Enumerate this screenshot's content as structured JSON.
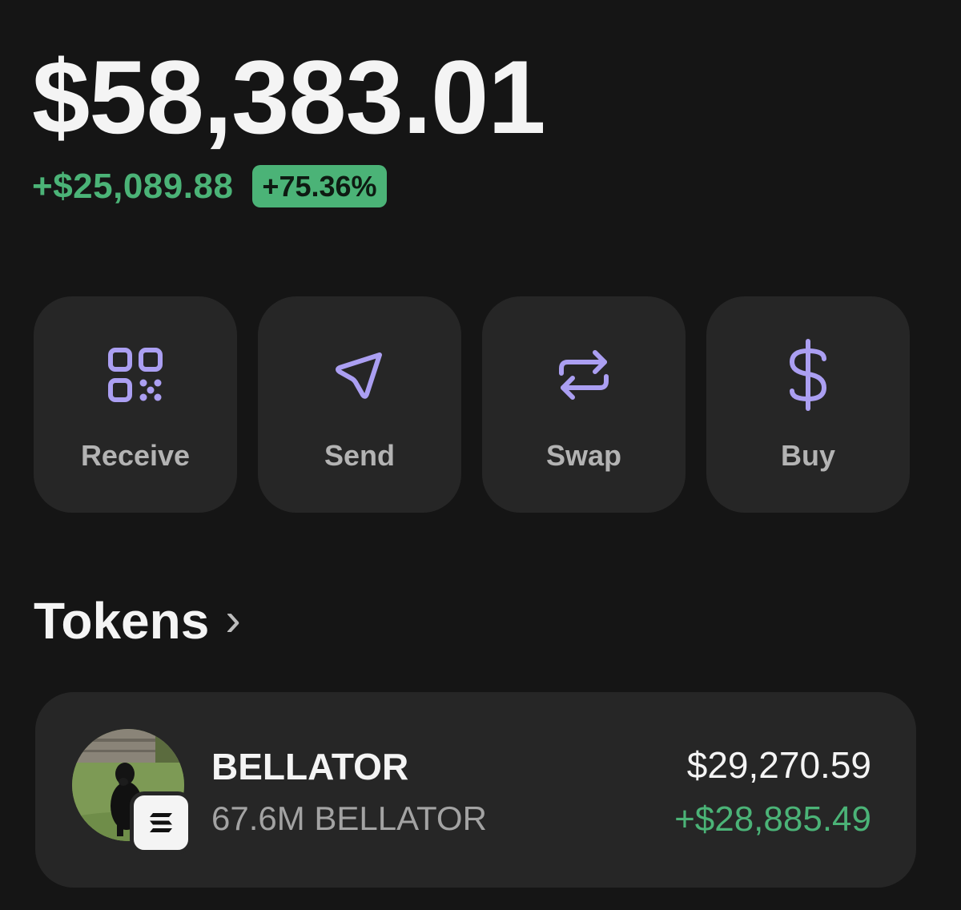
{
  "portfolio": {
    "balance": "$58,383.01",
    "change_amount": "+$25,089.88",
    "change_percent": "+75.36%"
  },
  "actions": [
    {
      "label": "Receive",
      "icon": "qr-code-icon"
    },
    {
      "label": "Send",
      "icon": "send-arrow-icon"
    },
    {
      "label": "Swap",
      "icon": "swap-arrows-icon"
    },
    {
      "label": "Buy",
      "icon": "dollar-icon"
    }
  ],
  "tokens": {
    "title": "Tokens",
    "items": [
      {
        "name": "BELLATOR",
        "amount": "67.6M BELLATOR",
        "value": "$29,270.59",
        "pnl": "+$28,885.49",
        "avatar": "dog-photo-avatar",
        "chain_badge": "solana-icon"
      }
    ]
  },
  "colors": {
    "background": "#151515",
    "card": "#262626",
    "accent_purple": "#ab9ff2",
    "positive_green": "#4bb377"
  }
}
